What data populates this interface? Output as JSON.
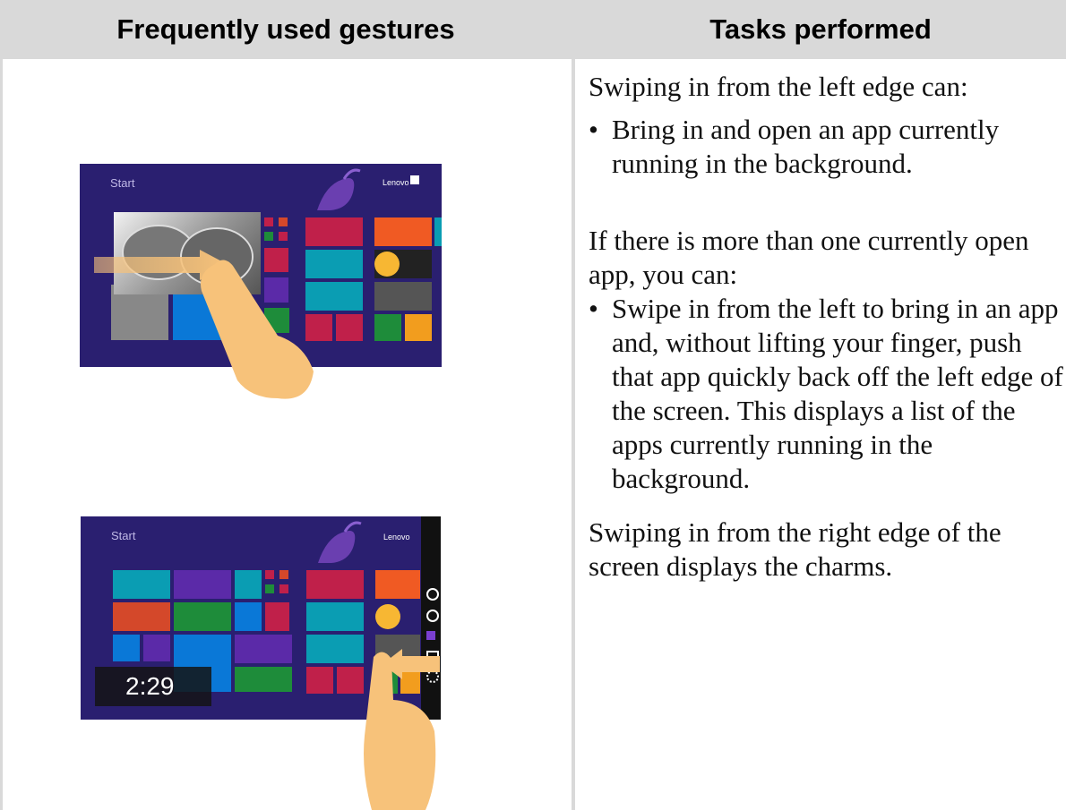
{
  "table": {
    "col_left_header": "Frequently used gestures",
    "col_right_header": "Tasks performed"
  },
  "tasks": {
    "left_edge_intro": "Swiping in from the left edge can:",
    "left_edge_bullet": "Bring in and open an app currently running in the background.",
    "multi_app_intro": "If there is more than one currently open app, you can:",
    "multi_app_bullet": "Swipe in from the left to bring in an app and, without lifting your finger, push that app quickly back off the left edge of the screen. This displays a list of the apps currently running in the background.",
    "right_edge_text": "Swiping in from the right edge of the screen displays the charms."
  },
  "screenshots": {
    "start_label": "Start",
    "user_label": "Lenovo",
    "clock_time": "2:29"
  },
  "colors": {
    "header_bg": "#d9d9d9",
    "start_bg": "#2a1f70",
    "finger": "#f7c27a"
  }
}
